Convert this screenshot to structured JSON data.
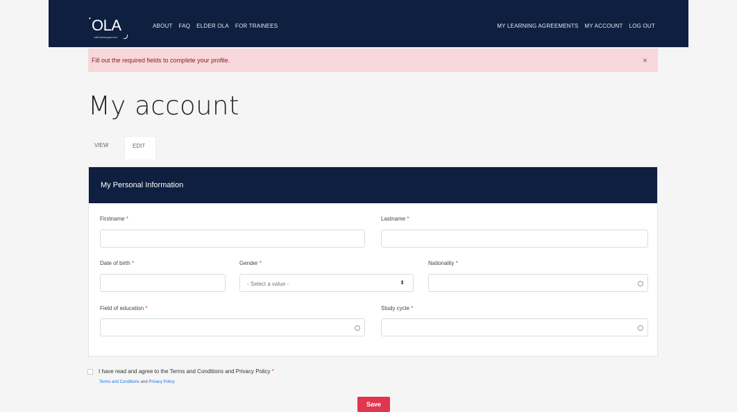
{
  "nav": {
    "logo": "OLA",
    "logo_sub": "online learning agreement",
    "left_links": [
      "ABOUT",
      "FAQ",
      "ELDER OLA",
      "FOR TRAINEES"
    ],
    "right_links": [
      "MY LEARNING AGREEMENTS",
      "MY ACCOUNT",
      "LOG OUT"
    ]
  },
  "alert": {
    "message": "Fill out the required fields to complete your profile.",
    "close": "×"
  },
  "page": {
    "title": "My account"
  },
  "tabs": {
    "view": "VIEW",
    "edit": "EDIT"
  },
  "panel": {
    "title": "My Personal Information",
    "required_mark": "*",
    "fields": {
      "firstname": {
        "label": "Firstname",
        "value": ""
      },
      "lastname": {
        "label": "Lastname",
        "value": ""
      },
      "dob": {
        "label": "Date of birth",
        "value": ""
      },
      "gender": {
        "label": "Gender",
        "value": "- Select a value -"
      },
      "nationality": {
        "label": "Nationality",
        "value": ""
      },
      "field_of_education": {
        "label": "Field of education",
        "value": ""
      },
      "study_cycle": {
        "label": "Study cycle",
        "value": ""
      }
    }
  },
  "terms": {
    "label": "I have read and agree to the Terms and Conditions and Privacy Policy",
    "link1": "Terms and Conditions",
    "and": "and",
    "link2": "Privacy Policy",
    "checked": false
  },
  "actions": {
    "save": "Save"
  },
  "colors": {
    "navy": "#0e1f3f",
    "alert_bg": "#f8d7da",
    "accent": "#e0364f",
    "required": "#dc3545"
  }
}
